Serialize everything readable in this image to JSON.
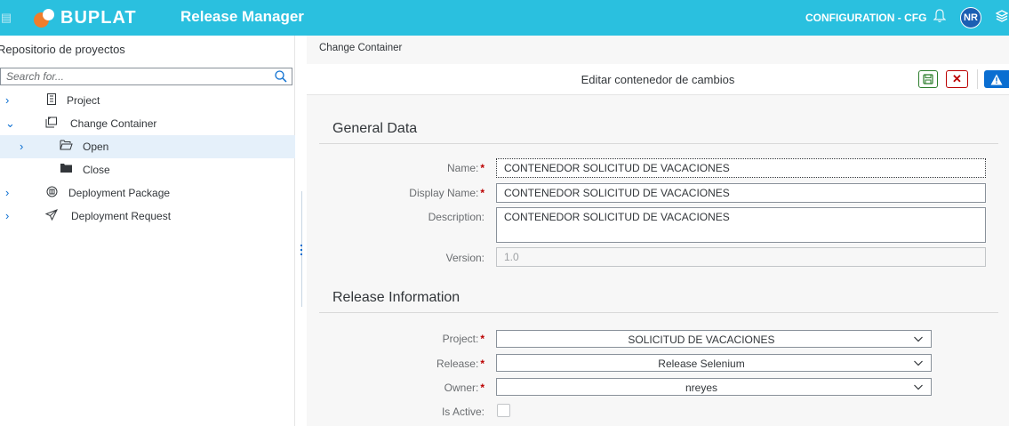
{
  "header": {
    "brand": "BUPLAT",
    "app_title": "Release Manager",
    "config_label": "CONFIGURATION - CFG",
    "avatar_initials": "NR",
    "bg_color": "#2ac0df"
  },
  "sidebar": {
    "title": "Repositorio de proyectos",
    "search_placeholder": "Search for...",
    "items": [
      {
        "label": "Project",
        "icon": "project-icon",
        "expanded": false
      },
      {
        "label": "Change Container",
        "icon": "change-container-icon",
        "expanded": true
      },
      {
        "label": "Open",
        "icon": "open-folder-icon",
        "selected": true
      },
      {
        "label": "Close",
        "icon": "closed-folder-icon"
      },
      {
        "label": "Deployment Package",
        "icon": "package-icon",
        "expanded": false
      },
      {
        "label": "Deployment Request",
        "icon": "send-icon",
        "expanded": false
      }
    ]
  },
  "main": {
    "breadcrumb": "Change Container",
    "page_title": "Editar contenedor de cambios",
    "general": {
      "title": "General Data",
      "name_label": "Name:",
      "name_value": "CONTENEDOR SOLICITUD DE VACACIONES",
      "display_label": "Display Name:",
      "display_value": "CONTENEDOR SOLICITUD DE VACACIONES",
      "desc_label": "Description:",
      "desc_value": "CONTENEDOR SOLICITUD DE VACACIONES",
      "version_label": "Version:",
      "version_value": "1.0"
    },
    "release": {
      "title": "Release Information",
      "project_label": "Project:",
      "project_value": "SOLICITUD DE VACACIONES",
      "release_label": "Release:",
      "release_value": "Release Selenium",
      "owner_label": "Owner:",
      "owner_value": "nreyes",
      "active_label": "Is Active:",
      "active_checked": false
    },
    "required_marker": "*"
  }
}
